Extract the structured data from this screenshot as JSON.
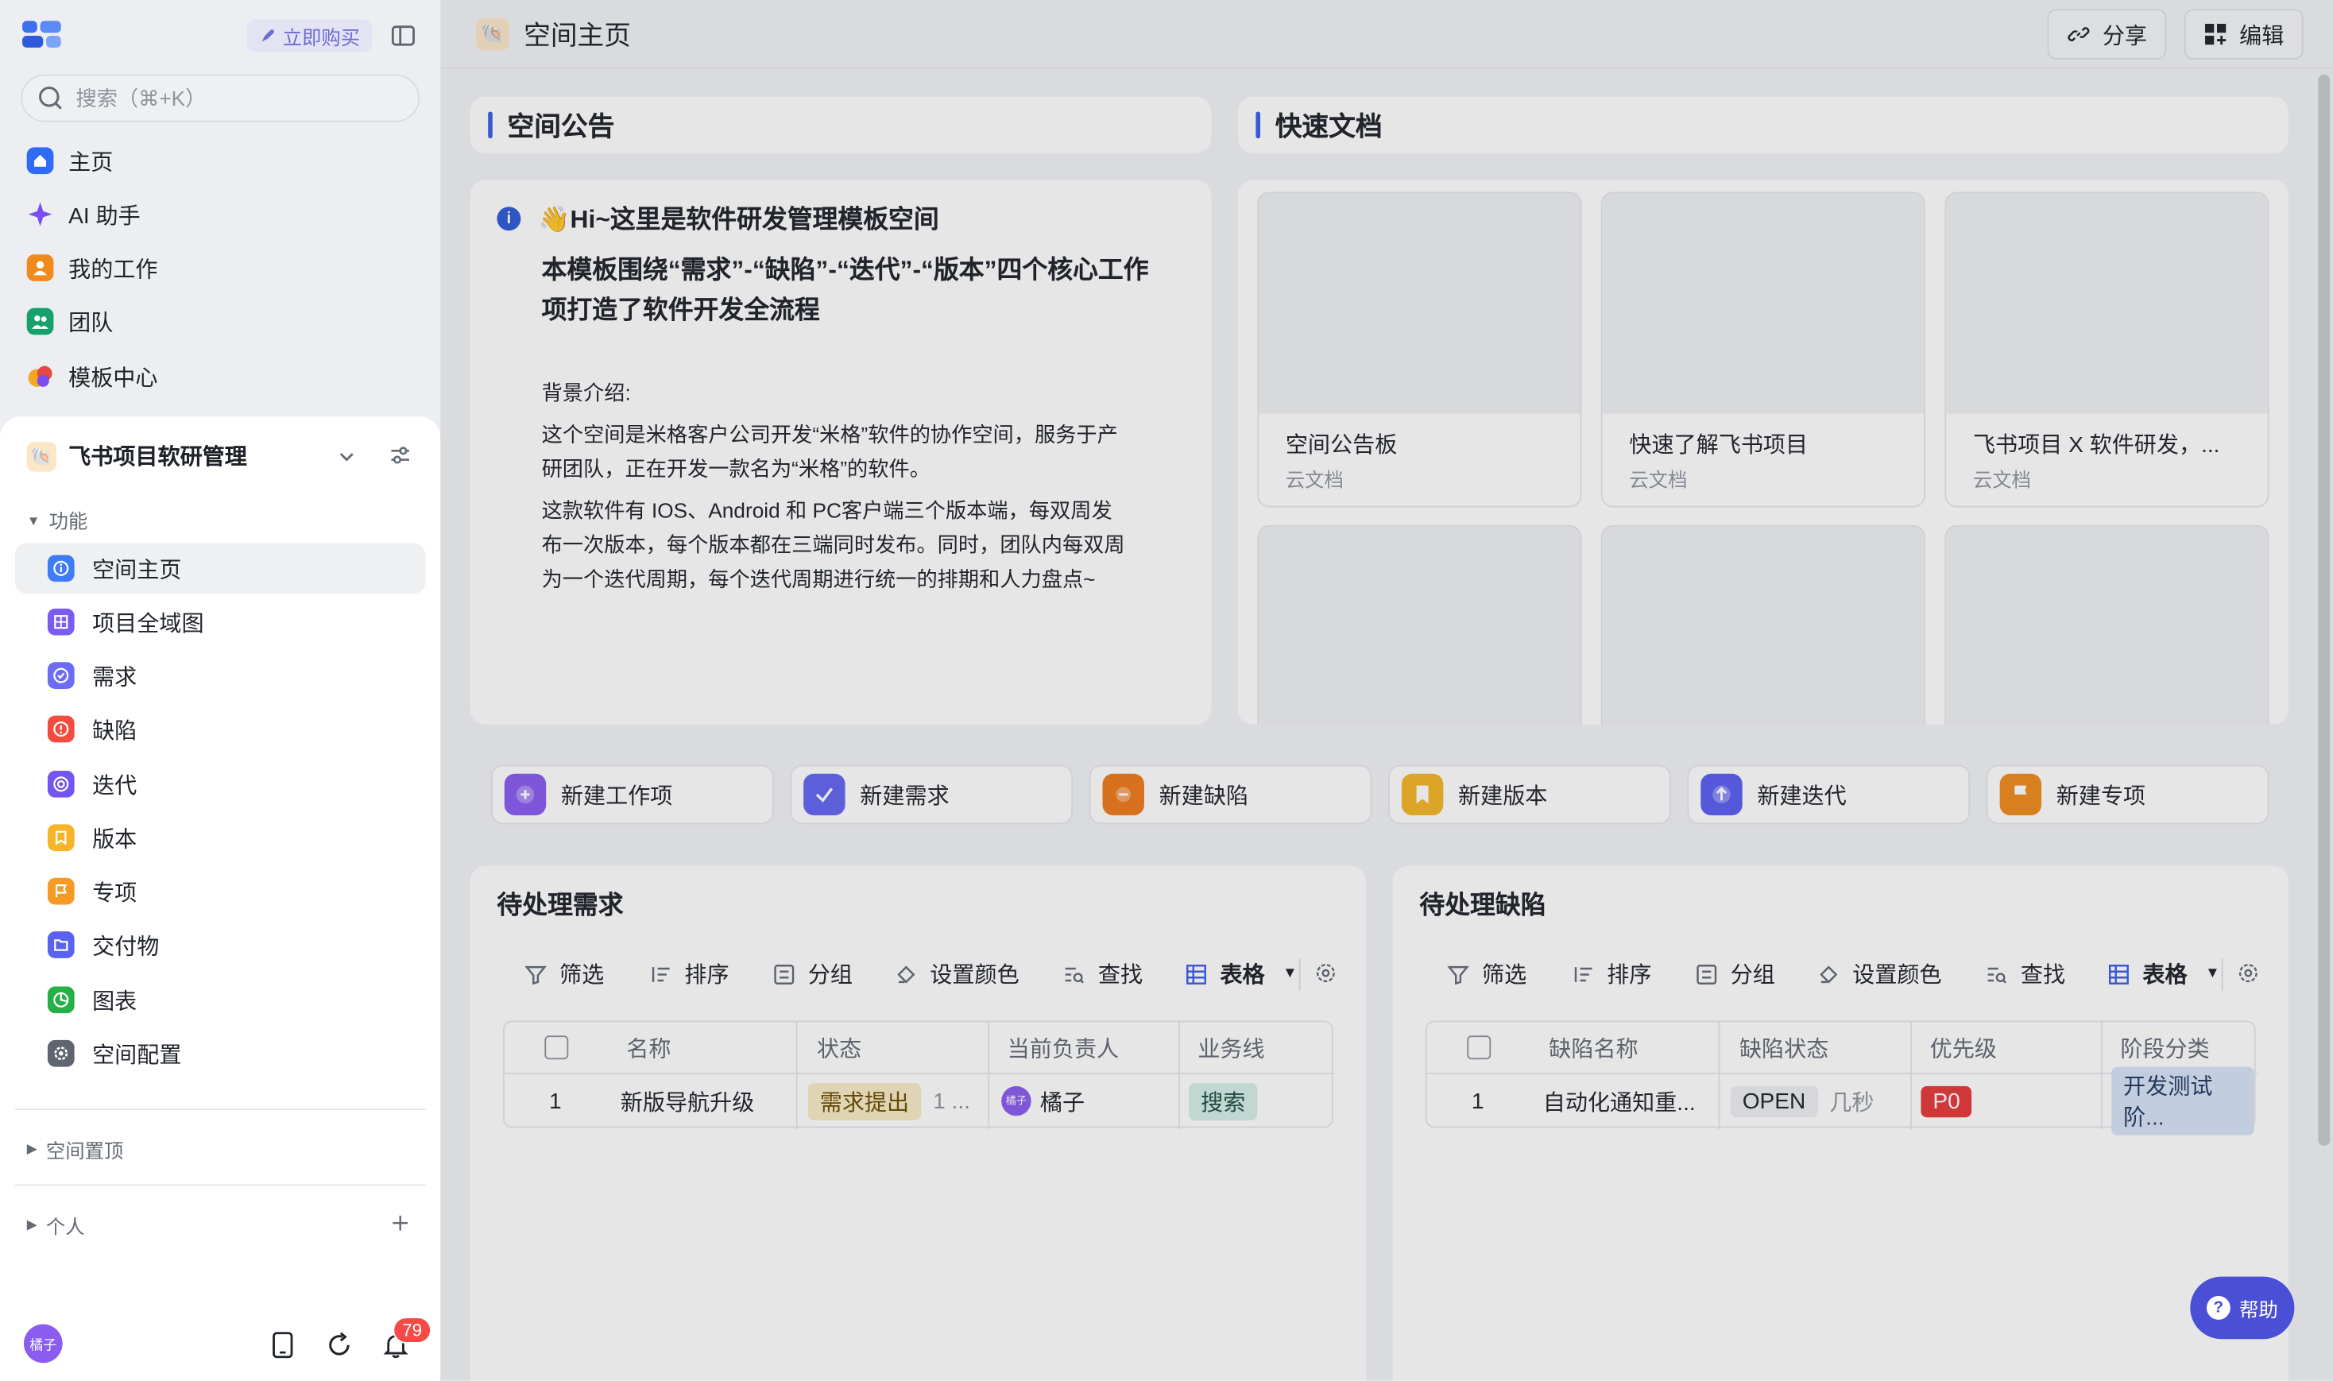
{
  "sidebar": {
    "buy_label": "立即购买",
    "search_placeholder": "搜索（⌘+K）",
    "nav": [
      {
        "label": "主页",
        "icon": "home-icon",
        "color": "#2f6bf5"
      },
      {
        "label": "AI 助手",
        "icon": "sparkle-icon",
        "color": "#7b4cf0"
      },
      {
        "label": "我的工作",
        "icon": "person-icon",
        "color": "#f08a1c"
      },
      {
        "label": "团队",
        "icon": "team-icon",
        "color": "#16a06c"
      },
      {
        "label": "模板中心",
        "icon": "template-icon",
        "color": "#e5483f"
      }
    ],
    "space": {
      "name": "飞书项目软研管理",
      "section_functions": "功能",
      "menu": [
        {
          "label": "空间主页",
          "icon": "info-icon",
          "color": "#3f7cf7"
        },
        {
          "label": "项目全域图",
          "icon": "grid-icon",
          "color": "#7a5cf0"
        },
        {
          "label": "需求",
          "icon": "check-circle-icon",
          "color": "#6c6cf5"
        },
        {
          "label": "缺陷",
          "icon": "alert-icon",
          "color": "#f04d3e"
        },
        {
          "label": "迭代",
          "icon": "cycle-icon",
          "color": "#7356f0"
        },
        {
          "label": "版本",
          "icon": "bookmark-icon",
          "color": "#f5b526"
        },
        {
          "label": "专项",
          "icon": "flag-icon",
          "color": "#f59a23"
        },
        {
          "label": "交付物",
          "icon": "folder-icon",
          "color": "#5a63f0"
        },
        {
          "label": "图表",
          "icon": "chart-icon",
          "color": "#24b045"
        },
        {
          "label": "空间配置",
          "icon": "settings-icon",
          "color": "#5e6470"
        }
      ],
      "section_pinned": "空间置顶",
      "section_personal": "个人"
    },
    "avatar_text": "橘子",
    "notification_count": "79"
  },
  "topbar": {
    "title": "空间主页",
    "share_label": "分享",
    "edit_label": "编辑"
  },
  "announcement": {
    "title": "空间公告",
    "heading": "👋Hi~这里是软件研发管理模板空间",
    "subheading_1": "本模板围绕“需求”-“缺陷”-“迭代”-“版本”四个核心工作",
    "subheading_2": "项打造了软件开发全流程",
    "bg_label": "背景介绍:",
    "p1_1": "这个空间是米格客户公司开发“米格”软件的协作空间，服务于产",
    "p1_2": "研团队，正在开发一款名为“米格”的软件。",
    "p2_1": "这款软件有 IOS、Android 和 PC客户端三个版本端，每双周发",
    "p2_2": "布一次版本，每个版本都在三端同时发布。同时，团队内每双周",
    "p2_3": "为一个迭代周期，每个迭代周期进行统一的排期和人力盘点~"
  },
  "quick_docs": {
    "title": "快速文档",
    "docs": [
      {
        "title": "空间公告板",
        "type": "云文档"
      },
      {
        "title": "快速了解飞书项目",
        "type": "云文档"
      },
      {
        "title": "飞书项目 X 软件研发，...",
        "type": "云文档"
      }
    ]
  },
  "quick_actions": [
    {
      "label": "新建工作项",
      "icon": "plus-icon",
      "color": "#8a5cf0"
    },
    {
      "label": "新建需求",
      "icon": "check-icon",
      "color": "#6366f1"
    },
    {
      "label": "新建缺陷",
      "icon": "bug-icon",
      "color": "#f07a1a"
    },
    {
      "label": "新建版本",
      "icon": "bookmark-icon",
      "color": "#f5b526"
    },
    {
      "label": "新建迭代",
      "icon": "arrow-up-icon",
      "color": "#5b5ff0"
    },
    {
      "label": "新建专项",
      "icon": "flag-icon",
      "color": "#f08a1c"
    }
  ],
  "toolbar": {
    "filter": "筛选",
    "sort": "排序",
    "group": "分组",
    "color": "设置颜色",
    "find": "查找",
    "view": "表格"
  },
  "pending_req": {
    "title": "待处理需求",
    "cols": [
      "名称",
      "状态",
      "当前负责人",
      "业务线"
    ],
    "row": {
      "index": "1",
      "name": "新版导航升级",
      "status": "需求提出",
      "status_extra": "1 ...",
      "owner_avatar": "橘子",
      "owner": "橘子",
      "biz": "搜索"
    }
  },
  "pending_bug": {
    "title": "待处理缺陷",
    "cols": [
      "缺陷名称",
      "缺陷状态",
      "优先级",
      "阶段分类"
    ],
    "row": {
      "index": "1",
      "name": "自动化通知重...",
      "status": "OPEN",
      "status_extra": "几秒",
      "priority": "P0",
      "stage": "开发测试阶..."
    }
  },
  "help_label": "帮助"
}
